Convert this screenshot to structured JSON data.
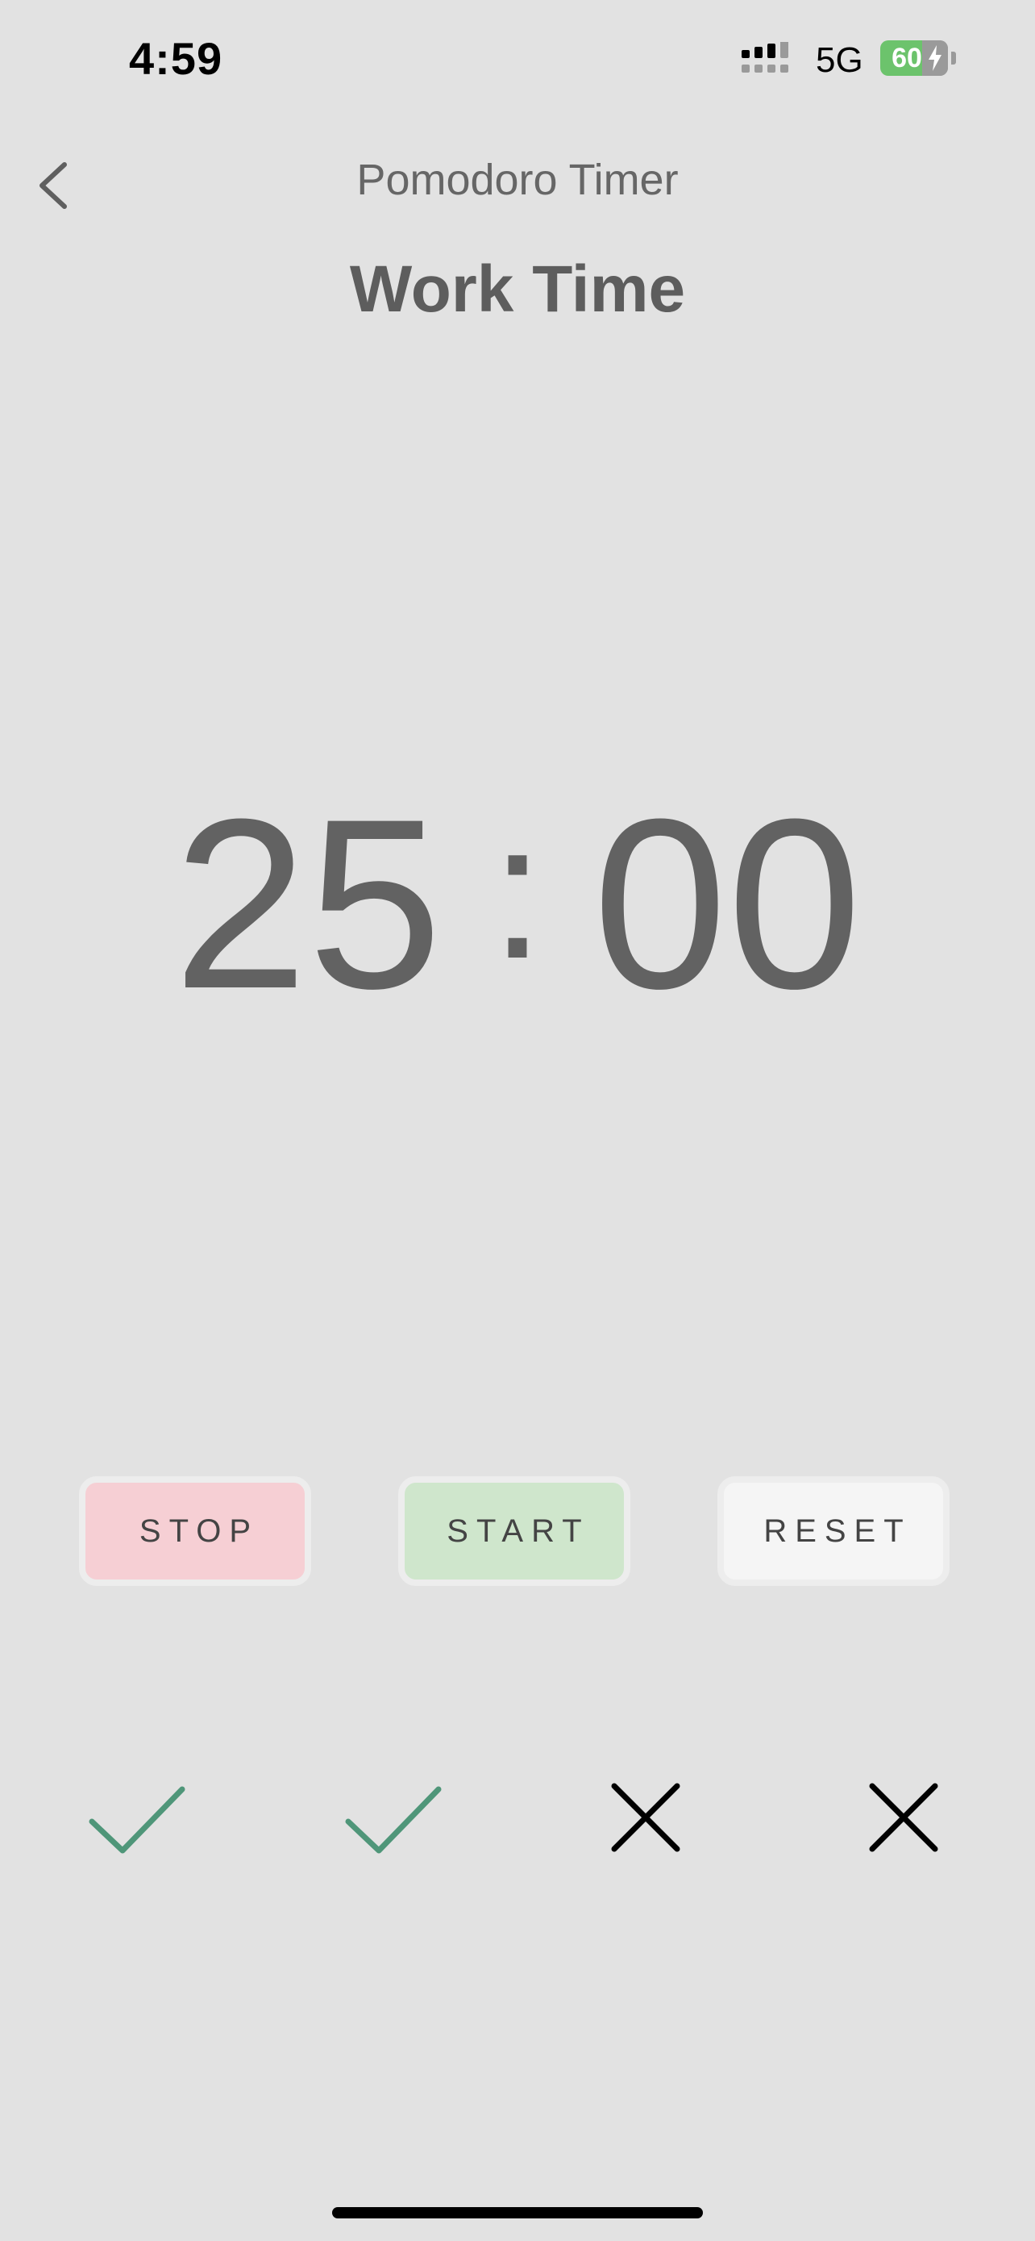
{
  "status_bar": {
    "time": "4:59",
    "network": "5G",
    "battery_percent": "60",
    "battery_charging": true
  },
  "header": {
    "back_icon": "chevron-left-icon",
    "title": "Pomodoro Timer"
  },
  "session": {
    "label": "Work Time"
  },
  "timer": {
    "minutes": "25",
    "separator": ":",
    "seconds": "00"
  },
  "controls": {
    "stop_label": "STOP",
    "start_label": "START",
    "reset_label": "RESET"
  },
  "session_markers": [
    {
      "status": "completed",
      "icon": "check-icon"
    },
    {
      "status": "completed",
      "icon": "check-icon"
    },
    {
      "status": "incomplete",
      "icon": "x-icon"
    },
    {
      "status": "incomplete",
      "icon": "x-icon"
    }
  ],
  "colors": {
    "background": "#e2e2e2",
    "stop_button": "#f6cfd4",
    "start_button": "#cfe6cc",
    "reset_button": "#f5f5f5",
    "check": "#4f9679",
    "cross": "#000000",
    "battery": "#6cc36c"
  }
}
